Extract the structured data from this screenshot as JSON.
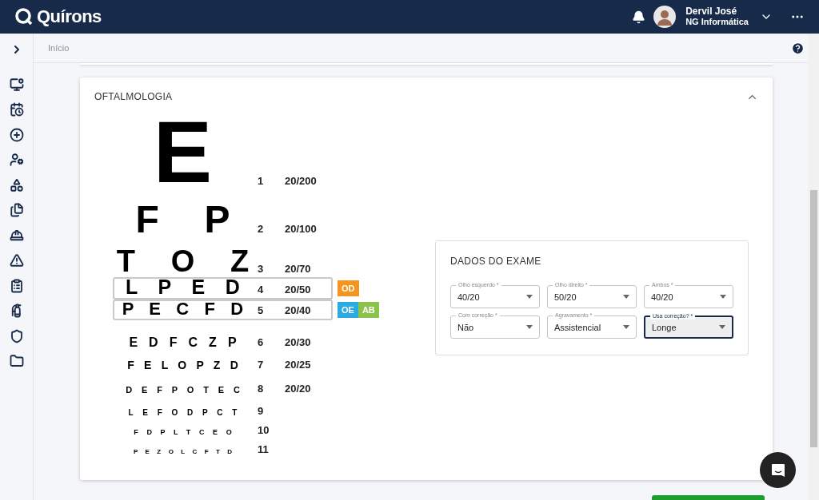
{
  "header": {
    "logo": "Quírons",
    "user": {
      "name": "Dervil José",
      "company": "NG Informática"
    }
  },
  "breadcrumb": "Início",
  "section": {
    "title": "OFTALMOLOGIA",
    "expanded": true
  },
  "chart_rows": [
    {
      "letters": "E",
      "line": "1",
      "acuity": "20/200",
      "highlighted": false
    },
    {
      "letters": "F P",
      "line": "2",
      "acuity": "20/100",
      "highlighted": false
    },
    {
      "letters": "T O Z",
      "line": "3",
      "acuity": "20/70",
      "highlighted": false
    },
    {
      "letters": "L P E D",
      "line": "4",
      "acuity": "20/50",
      "highlighted": true,
      "badges": [
        {
          "label": "OD",
          "color": "#f7941d"
        }
      ]
    },
    {
      "letters": "P E C F D",
      "line": "5",
      "acuity": "20/40",
      "highlighted": true,
      "badges": [
        {
          "label": "OE",
          "color": "#29abe2"
        },
        {
          "label": "AB",
          "color": "#8bc34a"
        }
      ]
    },
    {
      "letters": "E D F C Z P",
      "line": "6",
      "acuity": "20/30",
      "highlighted": false
    },
    {
      "letters": "F E L O P Z D",
      "line": "7",
      "acuity": "20/25",
      "highlighted": false
    },
    {
      "letters": "D E F P O T E C",
      "line": "8",
      "acuity": "20/20",
      "highlighted": false
    },
    {
      "letters": "L E F O D P C T",
      "line": "9",
      "highlighted": false
    },
    {
      "letters": "F D P L T C E O",
      "line": "10",
      "highlighted": false
    },
    {
      "letters": "P E Z O L C F T D",
      "line": "11",
      "highlighted": false
    }
  ],
  "exam": {
    "title": "DADOS DO EXAME",
    "fields": [
      {
        "label": "Olho esquerdo *",
        "value": "40/20",
        "focused": false
      },
      {
        "label": "Olho direito *",
        "value": "50/20",
        "focused": false
      },
      {
        "label": "Ambos *",
        "value": "40/20",
        "focused": false
      },
      {
        "label": "Com correção *",
        "value": "Não",
        "focused": false
      },
      {
        "label": "Agravamento *",
        "value": "Assistencial",
        "focused": false
      },
      {
        "label": "Usa correção? *",
        "value": "Longe",
        "focused": true
      }
    ]
  }
}
